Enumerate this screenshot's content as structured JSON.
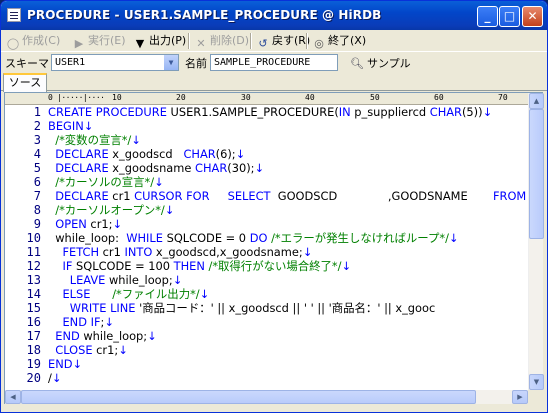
{
  "window": {
    "title": "PROCEDURE - USER1.SAMPLE_PROCEDURE @ HiRDB"
  },
  "toolbar": {
    "create": "作成(C)",
    "execute": "実行(E)",
    "output": "出力(P)",
    "delete": "削除(D)",
    "back": "戻す(R)",
    "exit": "終了(X)"
  },
  "schema": {
    "label": "スキーマ",
    "value": "USER1"
  },
  "name": {
    "label": "名前",
    "value": "SAMPLE_PROCEDURE"
  },
  "sample": {
    "label": "サンプル"
  },
  "tabs": [
    {
      "label": "ソース"
    }
  ],
  "ruler": {
    "marks": [
      "0",
      "10",
      "20",
      "30",
      "40",
      "50",
      "60",
      "70"
    ]
  },
  "editor": {
    "line_numbers": [
      "1",
      "2",
      "3",
      "4",
      "5",
      "6",
      "7",
      "8",
      "9",
      "10",
      "11",
      "12",
      "13",
      "14",
      "15",
      "16",
      "17",
      "18",
      "19",
      "20"
    ],
    "lines": [
      "CREATE PROCEDURE USER1.SAMPLE_PROCEDURE(IN p_suppliercd CHAR(5))↓",
      "BEGIN↓",
      "  /*変数の宣言*/↓",
      "  DECLARE x_goodscd   CHAR(6);↓",
      "  DECLARE x_goodsname CHAR(30);↓",
      "  /*カーソルの宣言*/↓",
      "  DECLARE cr1 CURSOR FOR     SELECT  GOODSCD              ,GOODSNAME       FROM",
      "  /*カーソルオープン*/↓",
      "  OPEN cr1;↓",
      "  while_loop:  WHILE SQLCODE = 0 DO /*エラーが発生しなければループ*/↓",
      "    FETCH cr1 INTO x_goodscd,x_goodsname;↓",
      "    IF SQLCODE = 100 THEN /*取得行がない場合終了*/↓",
      "      LEAVE while_loop;↓",
      "    ELSE      /*ファイル出力*/↓",
      "      WRITE LINE '商品コード：' || x_goodscd || ' ' || '商品名：' || x_gooc",
      "    END IF;↓",
      "  END while_loop;↓",
      "  CLOSE cr1;↓",
      "END↓",
      "/↓"
    ]
  }
}
